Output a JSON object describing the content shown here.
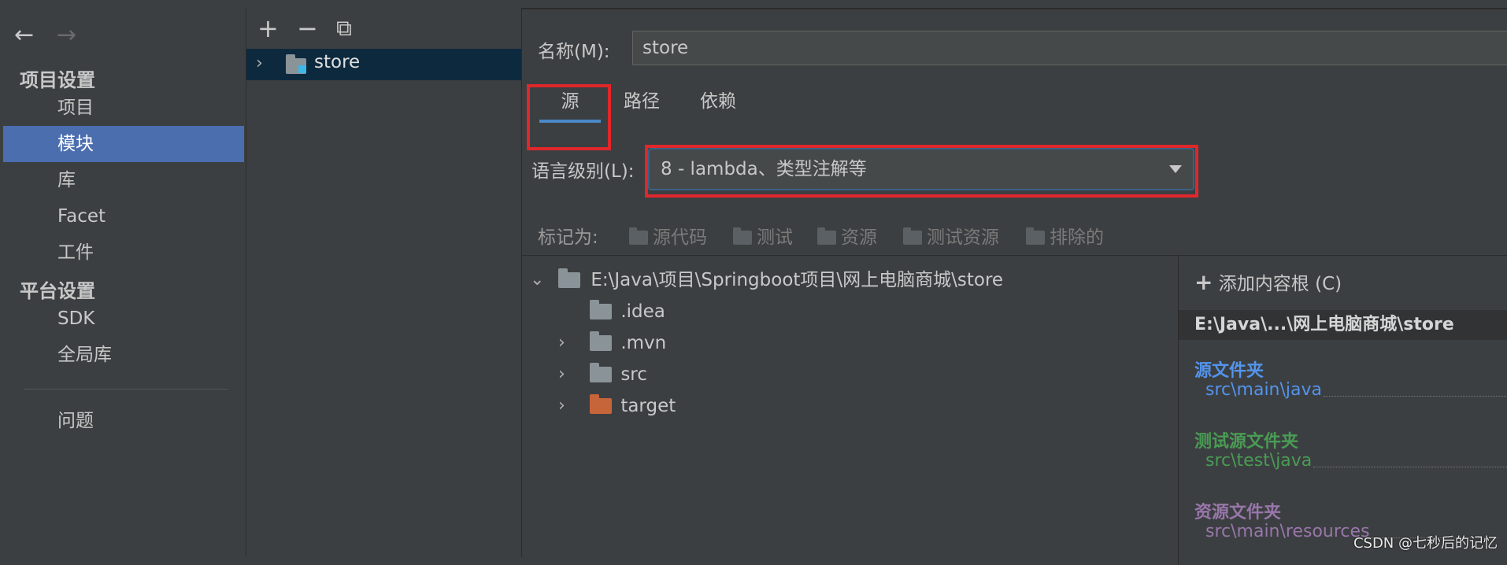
{
  "nav": {
    "back": "←",
    "forward": "→"
  },
  "sidebar": {
    "project_settings_header": "项目设置",
    "project_items": [
      "项目",
      "模块",
      "库",
      "Facet",
      "工件"
    ],
    "platform_settings_header": "平台设置",
    "platform_items": [
      "SDK",
      "全局库"
    ],
    "problems": "问题",
    "selected": "模块"
  },
  "module_toolbar": {
    "add": "+",
    "remove": "−",
    "copy": "⧉"
  },
  "module_tree": {
    "module_name": "store"
  },
  "name_field": {
    "label": "名称(M):",
    "value": "store"
  },
  "tabs": [
    {
      "label": "源",
      "active": true
    },
    {
      "label": "路径",
      "active": false
    },
    {
      "label": "依赖",
      "active": false
    }
  ],
  "language_level": {
    "label": "语言级别(L):",
    "value": "8 - lambda、类型注解等"
  },
  "mark_as": {
    "label": "标记为:",
    "items": [
      "源代码",
      "测试",
      "资源",
      "测试资源",
      "排除的"
    ]
  },
  "file_tree": {
    "root": "E:\\Java\\项目\\Springboot项目\\网上电脑商城\\store",
    "children": [
      ".idea",
      ".mvn",
      "src",
      "target"
    ]
  },
  "content_root": {
    "add_label": "添加内容根 (C)",
    "path": "E:\\Java\\...\\网上电脑商城\\store",
    "source_header": "源文件夹",
    "source_path": "src\\main\\java",
    "test_header": "测试源文件夹",
    "test_path": "src\\test\\java",
    "resource_header": "资源文件夹",
    "resource_path": "src\\main\\resources"
  },
  "colors": {
    "source": "#5394ec",
    "test": "#499c54",
    "resource": "#9876aa",
    "highlight_box": "#e0272b",
    "selection": "#4b6eaf"
  },
  "watermark": "CSDN @七秒后的记忆"
}
